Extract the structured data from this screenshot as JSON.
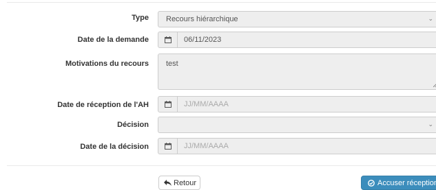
{
  "form": {
    "type": {
      "label": "Type",
      "value": "Recours hiérarchique"
    },
    "date_demande": {
      "label": "Date de la demande",
      "value": "06/11/2023"
    },
    "motivations": {
      "label": "Motivations du recours",
      "value": "test"
    },
    "date_reception_ah": {
      "label": "Date de réception de l'AH",
      "placeholder": "JJ/MM/AAAA"
    },
    "decision": {
      "label": "Décision",
      "value": ""
    },
    "date_decision": {
      "label": "Date de la décision",
      "placeholder": "JJ/MM/AAAA"
    }
  },
  "actions": {
    "back_label": "Retour",
    "acknowledge_label": "Accuser réception"
  },
  "icons": {
    "calendar": "calendar-icon",
    "dropdown": "chevron-down-icon",
    "back": "reply-icon",
    "acknowledge": "circle-check-icon"
  },
  "colors": {
    "primary": "#3c8dbc",
    "field_bg": "#eeeeee",
    "border": "#cccccc"
  }
}
